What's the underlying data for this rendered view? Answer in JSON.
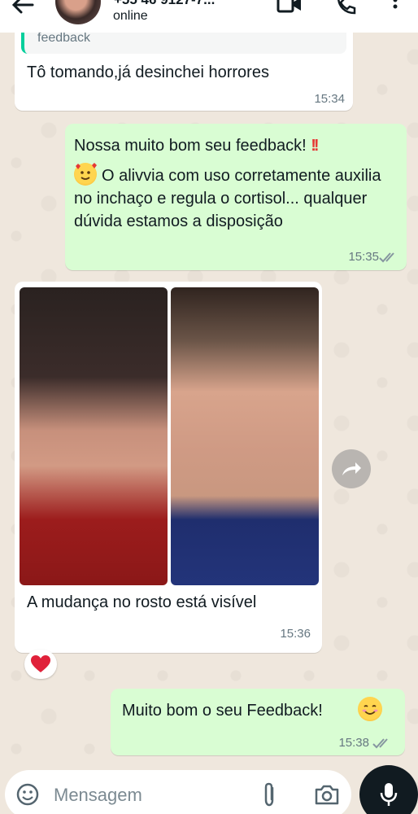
{
  "header": {
    "contact_name": "+55 46 9127-7...",
    "status": "online"
  },
  "messages": [
    {
      "direction": "in",
      "quoted_text": "feedback",
      "text": "Tô tomando,já desinchei horrores",
      "time": "15:34"
    },
    {
      "direction": "out",
      "line1": "Nossa muito bom seu feedback!",
      "line1_emoji": "!!",
      "text": "O alivvia com uso corretamente auxilia no inchaço e regula o cortisol... qualquer dúvida estamos a disposição",
      "time": "15:35",
      "status": "read"
    },
    {
      "direction": "in",
      "type": "image_album",
      "caption": "A mudança no rosto está visível",
      "time": "15:36",
      "reaction": "heart-emoji"
    },
    {
      "direction": "out",
      "text": "Muito bom o seu Feedback!",
      "time": "15:38",
      "status": "read"
    }
  ],
  "input": {
    "placeholder": "Mensagem"
  },
  "colors": {
    "outgoing_bubble": "#d9fdd3",
    "incoming_bubble": "#ffffff",
    "read_ticks": "#8696a0",
    "quote_bar": "#06cf9c"
  }
}
